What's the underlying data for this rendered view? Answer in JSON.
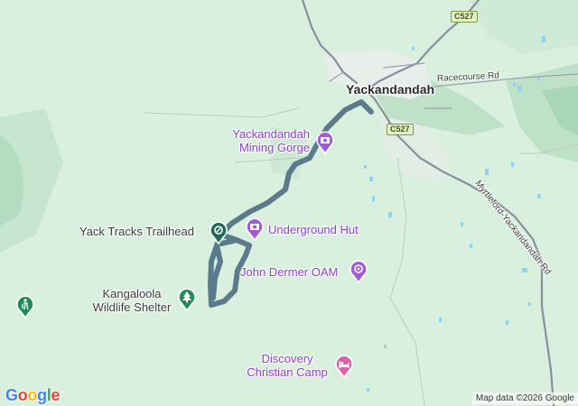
{
  "map": {
    "town": "Yackandandah",
    "roads": {
      "racecourse": "Racecourse Rd",
      "myrtleford": "Myrtleford-Yackandandah Rd"
    },
    "shields": {
      "north": "C527",
      "town": "C527"
    },
    "pois": {
      "mining_gorge": [
        "Yackandandah",
        "Mining Gorge"
      ],
      "trailhead": "Yack Tracks Trailhead",
      "underground_hut": "Underground Hut",
      "john_dermer": "John Dermer OAM",
      "kangaloola": [
        "Kangaloola",
        "Wildlife Shelter"
      ],
      "discovery": [
        "Discovery",
        "Christian Camp"
      ]
    },
    "colors": {
      "route": "#5b7a8c",
      "poi_purple": "#a35ad6",
      "park_green": "#1e8c5a",
      "background": "#d9f0de"
    },
    "icons": {
      "trailhead": "hiking-trail-icon",
      "mining_gorge": "camera-icon",
      "underground_hut": "camera-icon",
      "john_dermer": "attraction-icon",
      "kangaloola": "tree-icon",
      "discovery": "bed-icon",
      "left_edge": "hiker-icon"
    }
  },
  "footer": {
    "logo": [
      "G",
      "o",
      "o",
      "g",
      "l",
      "e"
    ],
    "attribution": "Map data ©2026 Google"
  }
}
